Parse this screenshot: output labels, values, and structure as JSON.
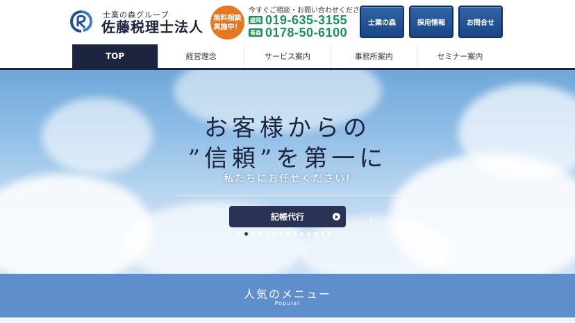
{
  "header": {
    "group_name": "士業の森グループ",
    "company_name": "佐藤税理士法人",
    "badge_lines": [
      "無料相談",
      "実施中！"
    ],
    "contact_note": "今すぐご相談・お問い合わせください!",
    "phones": [
      {
        "area": "盛岡",
        "number": "019-635-3155"
      },
      {
        "area": "青森",
        "number": "0178-50-6100"
      }
    ],
    "buttons": [
      "士業の森",
      "採用情報",
      "お問合せ"
    ]
  },
  "nav": {
    "items": [
      "TOP",
      "経営理念",
      "サービス案内",
      "事務所案内",
      "セミナー案内"
    ],
    "active_index": 0
  },
  "hero": {
    "title_line1": "お客様からの",
    "title_line2": "”信頼”を第一に",
    "subtitle": "私たちにお任せください!",
    "cta_label": "記帳代行",
    "prev_arrow": "‹",
    "next_arrow": "›",
    "slide_count": 14,
    "active_slide": 1
  },
  "popular": {
    "title": "人気のメニュー",
    "subtitle": "Popular"
  },
  "colors": {
    "navy": "#1d2440",
    "phone_green": "#1e8f5a",
    "badge_orange": "#e87722",
    "button_blue": "#1b4685",
    "popular_band": "#5e8ecb"
  }
}
